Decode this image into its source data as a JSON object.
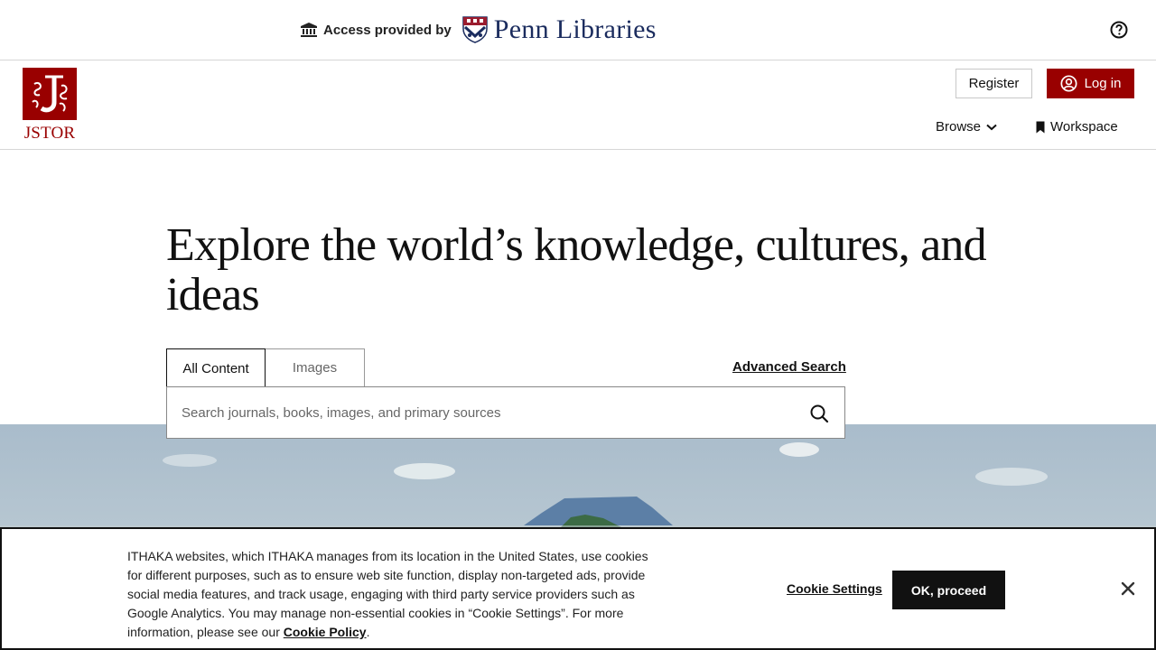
{
  "access_bar": {
    "prefix": "Access provided by",
    "institution": "Penn Libraries"
  },
  "header": {
    "logo_text": "JSTOR",
    "register_label": "Register",
    "login_label": "Log in",
    "browse_label": "Browse",
    "workspace_label": "Workspace"
  },
  "hero": {
    "title": "Explore the world’s knowledge, cultures, and ideas"
  },
  "search": {
    "tabs": [
      "All Content",
      "Images"
    ],
    "advanced_label": "Advanced Search",
    "placeholder": "Search journals, books, images, and primary sources"
  },
  "cookie_banner": {
    "text": "ITHAKA websites, which ITHAKA manages from its location in the United States, use cookies for different purposes, such as to ensure web site function, display non-targeted ads, provide social media features, and track usage, engaging with third party service providers such as Google Analytics. You may manage non-essential cookies in “Cookie Settings”. For more information, please see our ",
    "policy_link": "Cookie Policy",
    "settings_label": "Cookie Settings",
    "ok_label": "OK, proceed"
  },
  "colors": {
    "brand": "#990000",
    "penn_navy": "#1b2c5e",
    "dark": "#111111"
  },
  "icons": [
    "bank-icon",
    "penn-shield-icon",
    "help-icon",
    "user-icon",
    "chevron-down-icon",
    "bookmark-icon",
    "search-icon",
    "close-icon"
  ]
}
